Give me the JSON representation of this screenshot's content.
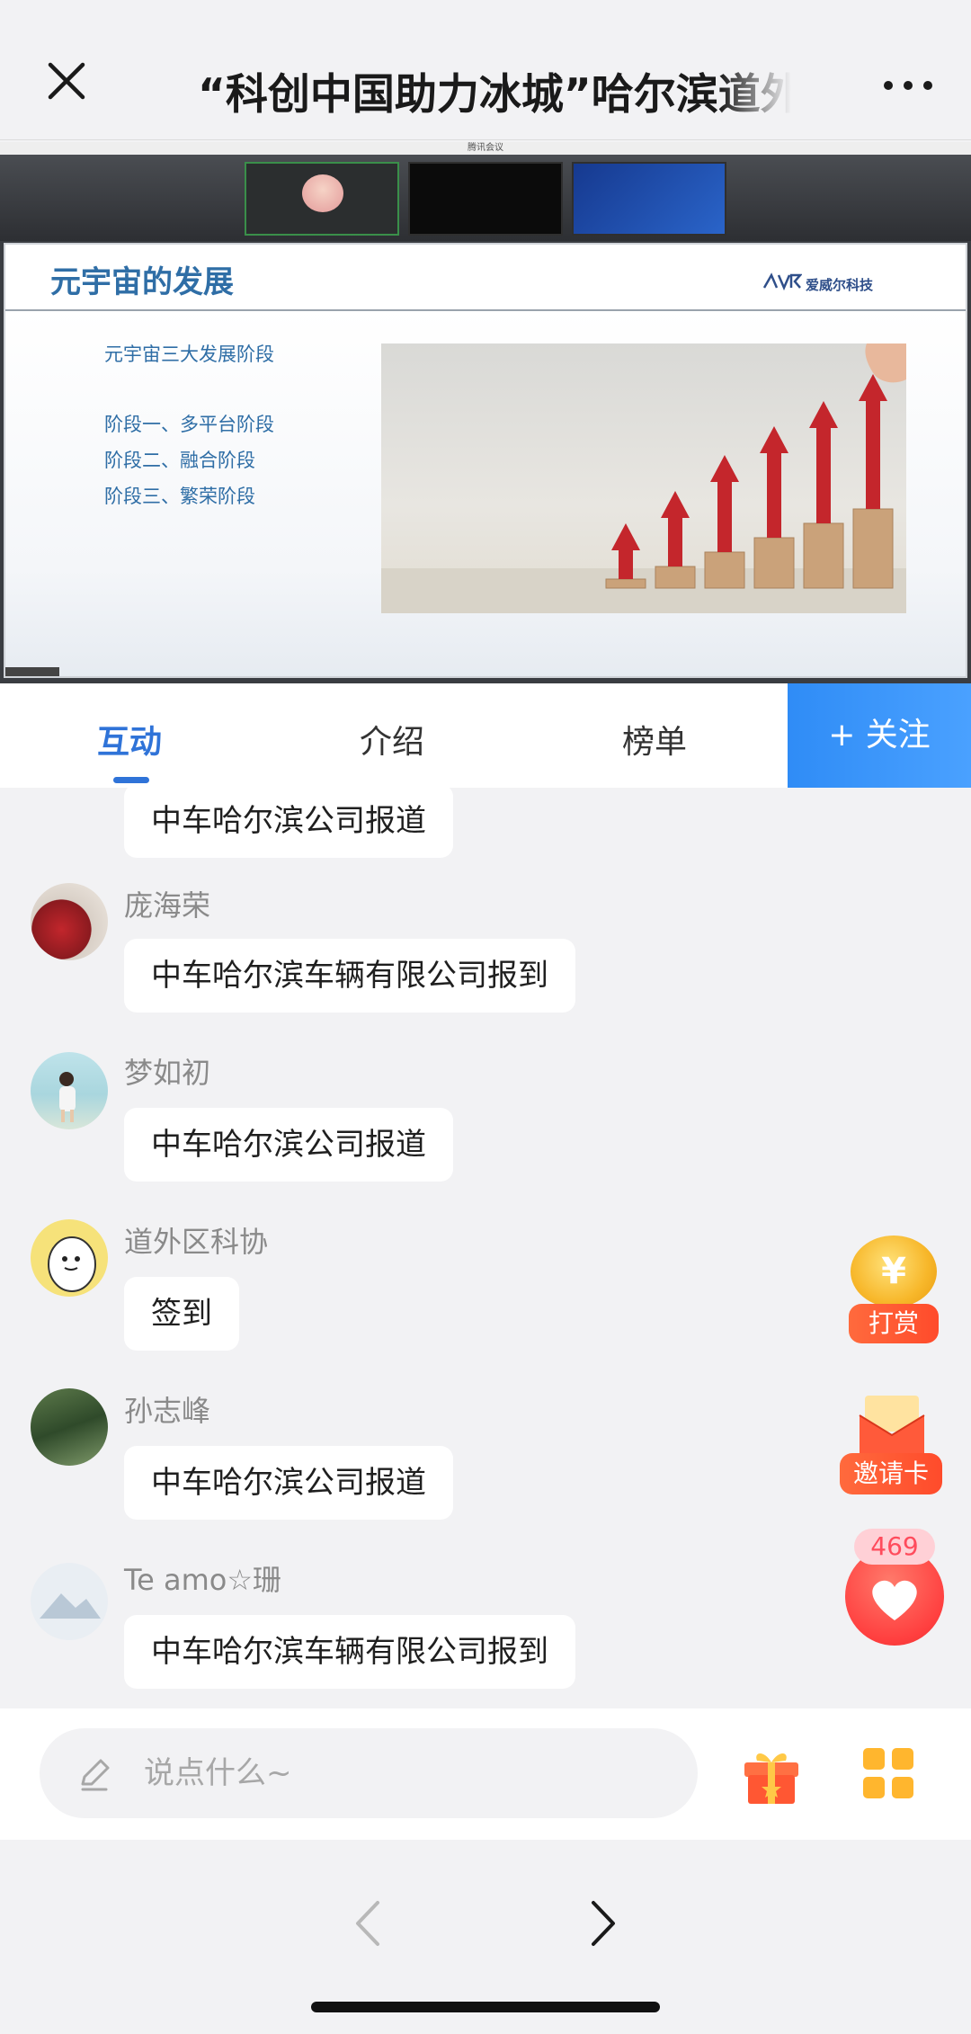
{
  "header": {
    "title": "“科创中国助力冰城”哈尔滨道外区",
    "close_icon": "close-icon",
    "more_icon": "more-dots-icon"
  },
  "video": {
    "meeting_app": "腾讯会议",
    "slide": {
      "title": "元宇宙的发展",
      "logo_text": "爱威尔科技",
      "subtitle": "元宇宙三大发展阶段",
      "stages": [
        "阶段一、多平台阶段",
        "阶段二、融合阶段",
        "阶段三、繁荣阶段"
      ]
    }
  },
  "tabs": {
    "items": [
      {
        "label": "互动",
        "active": true
      },
      {
        "label": "介绍",
        "active": false
      },
      {
        "label": "榜单",
        "active": false
      }
    ],
    "follow_label": "+ 关注"
  },
  "chat": {
    "partial_message": "中车哈尔滨公司报道",
    "messages": [
      {
        "user": "庞海荣",
        "text": "中车哈尔滨车辆有限公司报到"
      },
      {
        "user": "梦如初",
        "text": "中车哈尔滨公司报道"
      },
      {
        "user": "道外区科协",
        "text": "签到"
      },
      {
        "user": "孙志峰",
        "text": "中车哈尔滨公司报道"
      },
      {
        "user": "Te amo☆珊",
        "text": "中车哈尔滨车辆有限公司报到"
      }
    ]
  },
  "side": {
    "reward_label": "打赏",
    "reward_symbol": "¥",
    "invite_label": "邀请卡",
    "likes_count": "469"
  },
  "input": {
    "placeholder": "说点什么~",
    "value": ""
  },
  "colors": {
    "accent": "#2f73d8",
    "follow_bg": "#3b95f9",
    "orange": "#ff5533",
    "heart": "#ff3f3f"
  }
}
